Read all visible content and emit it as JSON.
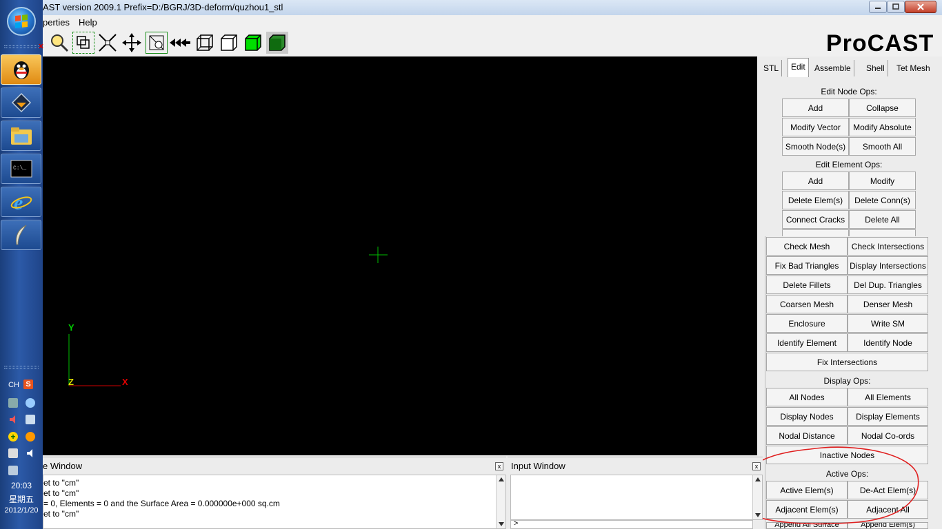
{
  "window": {
    "title": "AST version 2009.1   Prefix=D:/BGRJ/3D-deform/quzhou1_stl"
  },
  "menu": {
    "items": [
      "perties",
      "Help"
    ]
  },
  "logo": "ProCAST",
  "toolbar": {
    "tools": [
      "zoom-icon",
      "zoom-box-icon",
      "fit-icon",
      "pan-icon",
      "rotate-icon",
      "rewind-icon",
      "wireframe-box-icon",
      "hidden-line-box-icon",
      "shaded-green-box-icon",
      "shaded-dark-green-box-icon"
    ],
    "accent_green": "#00cc00"
  },
  "viewport": {
    "axis_y": "Y",
    "axis_z": "Z",
    "axis_x": "X"
  },
  "tabs": [
    "STL",
    "Edit",
    "Assemble",
    "Shell",
    "Tet Mesh"
  ],
  "active_tab": "Edit",
  "edit_node_ops": {
    "title": "Edit Node Ops:",
    "buttons": [
      "Add",
      "Collapse",
      "Modify Vector",
      "Modify Absolute",
      "Smooth Node(s)",
      "Smooth All"
    ]
  },
  "edit_element_ops": {
    "title": "Edit Element Ops:",
    "buttons": [
      "Add",
      "Modify",
      "Delete Elem(s)",
      "Delete Conn(s)",
      "Connect Cracks",
      "Delete All"
    ]
  },
  "popup": {
    "buttons": [
      "Check Mesh",
      "Check Intersections",
      "Fix Bad Triangles",
      "Display Intersections",
      "Delete Fillets",
      "Del Dup. Triangles",
      "Coarsen Mesh",
      "Denser Mesh",
      "Enclosure",
      "Write SM",
      "Identify Element",
      "Identify Node"
    ],
    "fix_intersections": "Fix Intersections",
    "display_ops_title": "Display Ops:",
    "display_buttons": [
      "All Nodes",
      "All Elements",
      "Display Nodes",
      "Display Elements",
      "Nodal Distance",
      "Nodal Co-ords"
    ],
    "inactive_nodes": "Inactive Nodes",
    "active_ops_title": "Active Ops:",
    "active_buttons": [
      "Active Elem(s)",
      "De-Act Elem(s)",
      "Adjacent Elem(s)",
      "Adjacent All"
    ],
    "partial_bottom": [
      "Append All Surface",
      "Append Elem(s)"
    ]
  },
  "message_window": {
    "title": "e Window",
    "lines": [
      "et to \"cm\"",
      "et to \"cm\"",
      "= 0,  Elements = 0 and the Surface Area = 0.000000e+000 sq.cm",
      "et to \"cm\""
    ]
  },
  "input_window": {
    "title": "Input Window",
    "prompt": ">"
  },
  "tray": {
    "lang": "CH",
    "time": "20:03",
    "day": "星期五",
    "date": "2012/1/20"
  },
  "annotation_color": "#e02020"
}
